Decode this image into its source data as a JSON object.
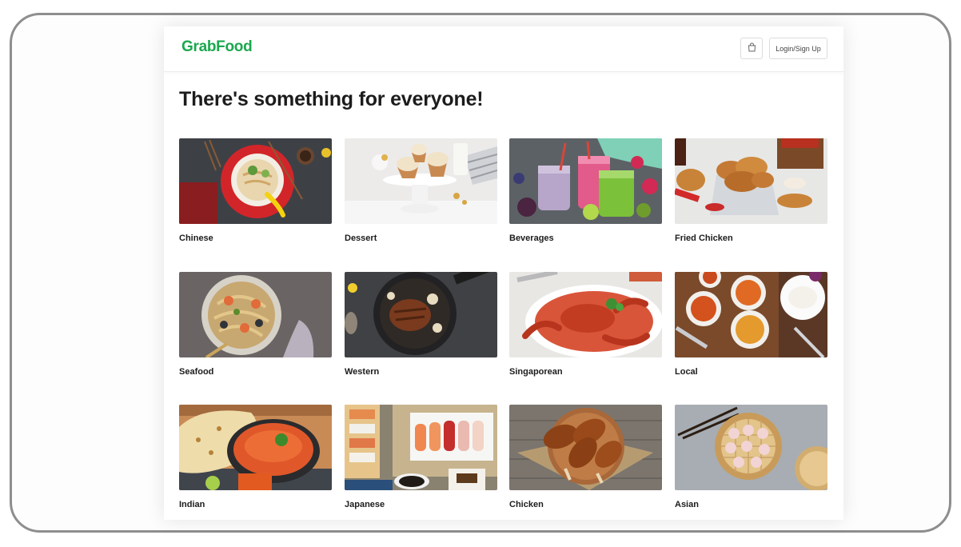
{
  "app": {
    "logo": "GrabFood",
    "cart_icon": "shopping-bag-icon",
    "login_label": "Login/Sign Up",
    "brand_color": "#1aa84e"
  },
  "main": {
    "title": "There's something for everyone!"
  },
  "categories": [
    {
      "label": "Chinese",
      "image": "noodle-bowl-image"
    },
    {
      "label": "Dessert",
      "image": "cupcakes-image"
    },
    {
      "label": "Beverages",
      "image": "smoothies-image"
    },
    {
      "label": "Fried Chicken",
      "image": "fried-chicken-image"
    },
    {
      "label": "Seafood",
      "image": "seafood-pasta-image"
    },
    {
      "label": "Western",
      "image": "steak-skillet-image"
    },
    {
      "label": "Singaporean",
      "image": "chilli-crab-image"
    },
    {
      "label": "Local",
      "image": "curry-dishes-image"
    },
    {
      "label": "Indian",
      "image": "curry-naan-image"
    },
    {
      "label": "Japanese",
      "image": "sushi-platter-image"
    },
    {
      "label": "Chicken",
      "image": "roast-drumsticks-image"
    },
    {
      "label": "Asian",
      "image": "dim-sum-basket-image"
    }
  ]
}
